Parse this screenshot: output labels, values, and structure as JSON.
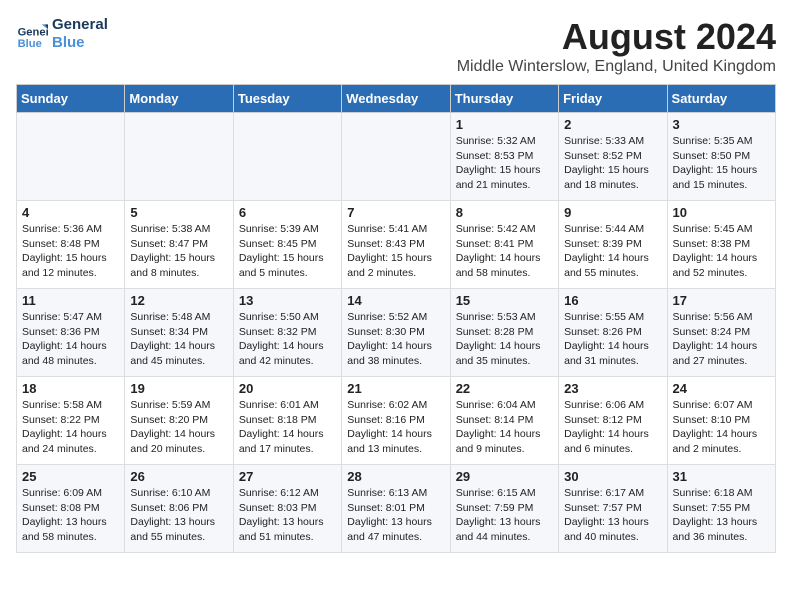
{
  "logo": {
    "line1": "General",
    "line2": "Blue"
  },
  "title": "August 2024",
  "subtitle": "Middle Winterslow, England, United Kingdom",
  "weekdays": [
    "Sunday",
    "Monday",
    "Tuesday",
    "Wednesday",
    "Thursday",
    "Friday",
    "Saturday"
  ],
  "weeks": [
    [
      {
        "day": "",
        "info": ""
      },
      {
        "day": "",
        "info": ""
      },
      {
        "day": "",
        "info": ""
      },
      {
        "day": "",
        "info": ""
      },
      {
        "day": "1",
        "info": "Sunrise: 5:32 AM\nSunset: 8:53 PM\nDaylight: 15 hours\nand 21 minutes."
      },
      {
        "day": "2",
        "info": "Sunrise: 5:33 AM\nSunset: 8:52 PM\nDaylight: 15 hours\nand 18 minutes."
      },
      {
        "day": "3",
        "info": "Sunrise: 5:35 AM\nSunset: 8:50 PM\nDaylight: 15 hours\nand 15 minutes."
      }
    ],
    [
      {
        "day": "4",
        "info": "Sunrise: 5:36 AM\nSunset: 8:48 PM\nDaylight: 15 hours\nand 12 minutes."
      },
      {
        "day": "5",
        "info": "Sunrise: 5:38 AM\nSunset: 8:47 PM\nDaylight: 15 hours\nand 8 minutes."
      },
      {
        "day": "6",
        "info": "Sunrise: 5:39 AM\nSunset: 8:45 PM\nDaylight: 15 hours\nand 5 minutes."
      },
      {
        "day": "7",
        "info": "Sunrise: 5:41 AM\nSunset: 8:43 PM\nDaylight: 15 hours\nand 2 minutes."
      },
      {
        "day": "8",
        "info": "Sunrise: 5:42 AM\nSunset: 8:41 PM\nDaylight: 14 hours\nand 58 minutes."
      },
      {
        "day": "9",
        "info": "Sunrise: 5:44 AM\nSunset: 8:39 PM\nDaylight: 14 hours\nand 55 minutes."
      },
      {
        "day": "10",
        "info": "Sunrise: 5:45 AM\nSunset: 8:38 PM\nDaylight: 14 hours\nand 52 minutes."
      }
    ],
    [
      {
        "day": "11",
        "info": "Sunrise: 5:47 AM\nSunset: 8:36 PM\nDaylight: 14 hours\nand 48 minutes."
      },
      {
        "day": "12",
        "info": "Sunrise: 5:48 AM\nSunset: 8:34 PM\nDaylight: 14 hours\nand 45 minutes."
      },
      {
        "day": "13",
        "info": "Sunrise: 5:50 AM\nSunset: 8:32 PM\nDaylight: 14 hours\nand 42 minutes."
      },
      {
        "day": "14",
        "info": "Sunrise: 5:52 AM\nSunset: 8:30 PM\nDaylight: 14 hours\nand 38 minutes."
      },
      {
        "day": "15",
        "info": "Sunrise: 5:53 AM\nSunset: 8:28 PM\nDaylight: 14 hours\nand 35 minutes."
      },
      {
        "day": "16",
        "info": "Sunrise: 5:55 AM\nSunset: 8:26 PM\nDaylight: 14 hours\nand 31 minutes."
      },
      {
        "day": "17",
        "info": "Sunrise: 5:56 AM\nSunset: 8:24 PM\nDaylight: 14 hours\nand 27 minutes."
      }
    ],
    [
      {
        "day": "18",
        "info": "Sunrise: 5:58 AM\nSunset: 8:22 PM\nDaylight: 14 hours\nand 24 minutes."
      },
      {
        "day": "19",
        "info": "Sunrise: 5:59 AM\nSunset: 8:20 PM\nDaylight: 14 hours\nand 20 minutes."
      },
      {
        "day": "20",
        "info": "Sunrise: 6:01 AM\nSunset: 8:18 PM\nDaylight: 14 hours\nand 17 minutes."
      },
      {
        "day": "21",
        "info": "Sunrise: 6:02 AM\nSunset: 8:16 PM\nDaylight: 14 hours\nand 13 minutes."
      },
      {
        "day": "22",
        "info": "Sunrise: 6:04 AM\nSunset: 8:14 PM\nDaylight: 14 hours\nand 9 minutes."
      },
      {
        "day": "23",
        "info": "Sunrise: 6:06 AM\nSunset: 8:12 PM\nDaylight: 14 hours\nand 6 minutes."
      },
      {
        "day": "24",
        "info": "Sunrise: 6:07 AM\nSunset: 8:10 PM\nDaylight: 14 hours\nand 2 minutes."
      }
    ],
    [
      {
        "day": "25",
        "info": "Sunrise: 6:09 AM\nSunset: 8:08 PM\nDaylight: 13 hours\nand 58 minutes."
      },
      {
        "day": "26",
        "info": "Sunrise: 6:10 AM\nSunset: 8:06 PM\nDaylight: 13 hours\nand 55 minutes."
      },
      {
        "day": "27",
        "info": "Sunrise: 6:12 AM\nSunset: 8:03 PM\nDaylight: 13 hours\nand 51 minutes."
      },
      {
        "day": "28",
        "info": "Sunrise: 6:13 AM\nSunset: 8:01 PM\nDaylight: 13 hours\nand 47 minutes."
      },
      {
        "day": "29",
        "info": "Sunrise: 6:15 AM\nSunset: 7:59 PM\nDaylight: 13 hours\nand 44 minutes."
      },
      {
        "day": "30",
        "info": "Sunrise: 6:17 AM\nSunset: 7:57 PM\nDaylight: 13 hours\nand 40 minutes."
      },
      {
        "day": "31",
        "info": "Sunrise: 6:18 AM\nSunset: 7:55 PM\nDaylight: 13 hours\nand 36 minutes."
      }
    ]
  ]
}
